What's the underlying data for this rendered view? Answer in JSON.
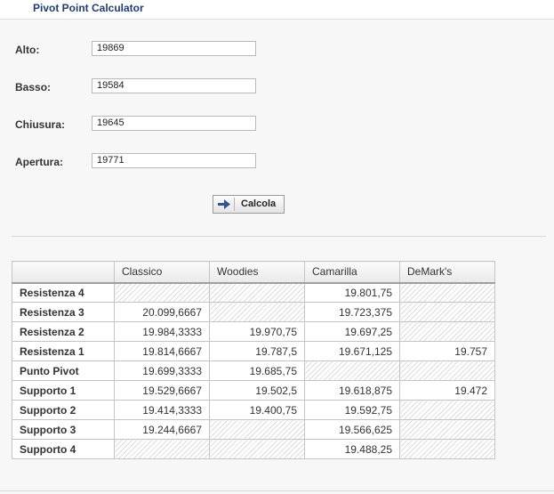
{
  "app": {
    "title": "Pivot Point Calculator"
  },
  "form": {
    "fields": [
      {
        "label": "Alto:",
        "value": "19869"
      },
      {
        "label": "Basso:",
        "value": "19584"
      },
      {
        "label": "Chiusura:",
        "value": "19645"
      },
      {
        "label": "Apertura:",
        "value": "19771"
      }
    ],
    "calc_button": {
      "label": "Calcola",
      "icon": "arrow-right-icon"
    }
  },
  "table": {
    "headers": [
      "",
      "Classico",
      "Woodies",
      "Camarilla",
      "DeMark's"
    ],
    "rows": [
      {
        "label": "Resistenza 4",
        "classico": "",
        "woodies": "",
        "camarilla": "19.801,75",
        "demark": ""
      },
      {
        "label": "Resistenza 3",
        "classico": "20.099,6667",
        "woodies": "",
        "camarilla": "19.723,375",
        "demark": ""
      },
      {
        "label": "Resistenza 2",
        "classico": "19.984,3333",
        "woodies": "19.970,75",
        "camarilla": "19.697,25",
        "demark": ""
      },
      {
        "label": "Resistenza 1",
        "classico": "19.814,6667",
        "woodies": "19.787,5",
        "camarilla": "19.671,125",
        "demark": "19.757"
      },
      {
        "label": "Punto Pivot",
        "classico": "19.699,3333",
        "woodies": "19.685,75",
        "camarilla": "",
        "demark": ""
      },
      {
        "label": "Supporto 1",
        "classico": "19.529,6667",
        "woodies": "19.502,5",
        "camarilla": "19.618,875",
        "demark": "19.472"
      },
      {
        "label": "Supporto 2",
        "classico": "19.414,3333",
        "woodies": "19.400,75",
        "camarilla": "19.592,75",
        "demark": ""
      },
      {
        "label": "Supporto 3",
        "classico": "19.244,6667",
        "woodies": "",
        "camarilla": "19.566,625",
        "demark": ""
      },
      {
        "label": "Supporto 4",
        "classico": "",
        "woodies": "",
        "camarilla": "19.488,25",
        "demark": ""
      }
    ]
  },
  "colors": {
    "title": "#1f3c74",
    "background": "#f7f7f7",
    "arrow": "#2f5597"
  }
}
